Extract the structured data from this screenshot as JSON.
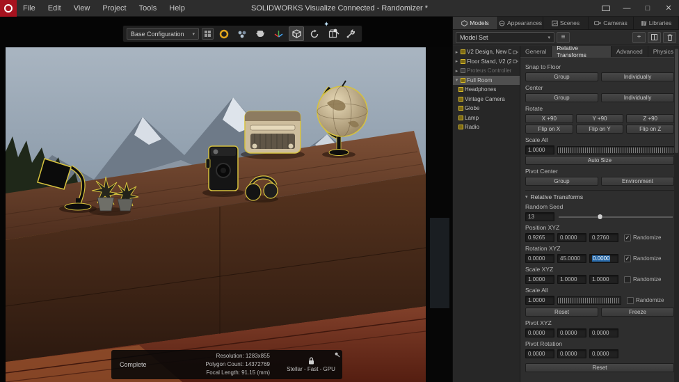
{
  "colors": {
    "accent_yellow": "#d6c23e",
    "selection_blue": "#2668a8",
    "logo_red": "#a6121f"
  },
  "menubar": {
    "items": [
      "File",
      "Edit",
      "View",
      "Project",
      "Tools",
      "Help"
    ],
    "title": "SOLIDWORKS Visualize Connected - Randomizer *"
  },
  "viewport": {
    "toolbar": {
      "configuration": "Base Configuration"
    },
    "status": {
      "state": "Complete",
      "resolution": "Resolution: 1283x855",
      "polygons": "Polygon Count: 14372769",
      "focal_length": "Focal Length: 91.15 (mm)",
      "renderer": "Stellar - Fast - GPU"
    }
  },
  "panel": {
    "tabs": [
      {
        "label": "Models"
      },
      {
        "label": "Appearances"
      },
      {
        "label": "Scenes"
      },
      {
        "label": "Cameras"
      },
      {
        "label": "Libraries"
      }
    ],
    "model_set": "Model Set",
    "tree": [
      {
        "arrow": "▸",
        "label": "V2 Design, New D..."
      },
      {
        "arrow": "▸",
        "label": "Floor Stand, V2 (2..."
      },
      {
        "arrow": "▸",
        "label": "Proteus Controller"
      },
      {
        "arrow": "▾",
        "label": "Full Room"
      },
      {
        "arrow": "",
        "label": "Headphones"
      },
      {
        "arrow": "",
        "label": "Vintage Camera"
      },
      {
        "arrow": "",
        "label": "Globe"
      },
      {
        "arrow": "",
        "label": "Lamp"
      },
      {
        "arrow": "",
        "label": "Radio"
      }
    ],
    "subtabs": [
      "General",
      "Relative Transforms",
      "Advanced",
      "Physics"
    ],
    "sections": {
      "snap_to_floor": "Snap to Floor",
      "center": "Center",
      "rotate": "Rotate",
      "scale_all": "Scale All",
      "pivot_center": "Pivot Center",
      "relative_transforms": "Relative Transforms",
      "random_seed": "Random Seed",
      "position_xyz": "Position XYZ",
      "rotation_xyz": "Rotation XYZ",
      "scale_xyz": "Scale XYZ",
      "scale_all2": "Scale All",
      "pivot_xyz": "Pivot XYZ",
      "pivot_rotation": "Pivot Rotation"
    },
    "buttons": {
      "group": "Group",
      "individually": "Individually",
      "x90": "X +90",
      "y90": "Y +90",
      "z90": "Z +90",
      "flip_x": "Flip on X",
      "flip_y": "Flip on Y",
      "flip_z": "Flip on Z",
      "auto_size": "Auto Size",
      "environment": "Environment",
      "reset": "Reset",
      "freeze": "Freeze",
      "randomize": "Randomize"
    },
    "values": {
      "scale_all_top": "1.0000",
      "random_seed": "13",
      "position": [
        "0.9265",
        "0.0000",
        "0.2760"
      ],
      "rotation": [
        "0.0000",
        "45.0000",
        "0.0000"
      ],
      "scale": [
        "1.0000",
        "1.0000",
        "1.0000"
      ],
      "scale_all": "1.0000",
      "pivot": [
        "0.0000",
        "0.0000",
        "0.0000"
      ],
      "pivot_rotation": [
        "0.0000",
        "0.0000",
        "0.0000"
      ]
    },
    "checks": {
      "position": "✓",
      "rotation": "✓",
      "scale": "",
      "scale_all": ""
    }
  }
}
